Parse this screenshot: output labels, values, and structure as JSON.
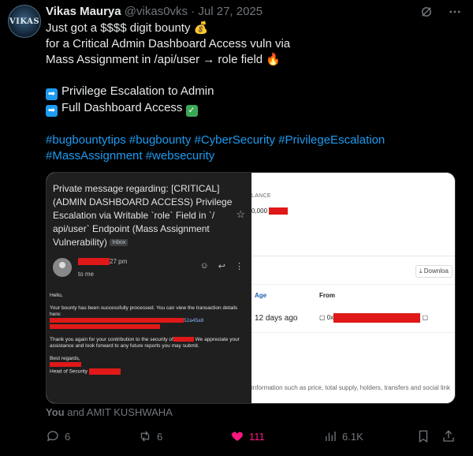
{
  "author": {
    "name": "Vikas Maurya",
    "handle": "@vikas0vks",
    "separator": "·",
    "date": "Jul 27, 2025",
    "avatar_text": "VIKAS"
  },
  "body": {
    "line1": "Just got a $$$$ digit bounty 💰",
    "line2": "for a Critical Admin Dashboard Access vuln via",
    "line3": "Mass Assignment in /api/user → role field 🔥",
    "bullet1": "Privilege Escalation to Admin",
    "bullet2": "Full Dashboard Access",
    "bullet_arrow": "➡",
    "check": "✓",
    "hashtags_line1": "#bugbountytips #bugbounty #CyberSecurity #PrivilegeEscalation",
    "hashtags_line2": "#MassAssignment #websecurity"
  },
  "email": {
    "subject": "Private message regarding: [CRITICAL] (ADMIN DASHBOARD ACCESS) Privilege Escalation via Writable `role` Field in `/ api/user` Endpoint (Mass Assignment Vulnerability)",
    "inbox_tag": "Inbox",
    "time_suffix": "27 pm",
    "to": "to me",
    "greeting": "Hello,",
    "para1": "Your bounty has been successfully processed. You can view the transaction details here:",
    "link_tail": "52a45a9",
    "para2_a": "Thank you again for your contribution to the security of",
    "para2_b": "We appreciate your assistance and look forward to any future reports you may submit.",
    "regards": "Best regards,",
    "signoff": "Head of Security"
  },
  "explorer": {
    "balance_label": "LANCE",
    "balance_value": "0,000",
    "download": "Downloa",
    "col_age": "Age",
    "col_from": "From",
    "age_value": "12 days ago",
    "from_prefix": "0x",
    "footer_note": "information such as price, total supply, holders, transfers and social link"
  },
  "liked_by": {
    "you": "You",
    "rest": "and AMIT KUSHWAHA"
  },
  "actions": {
    "replies": "6",
    "reposts": "6",
    "likes": "111",
    "views": "6.1K"
  },
  "colors": {
    "link": "#1d9bf0",
    "like": "#f91880",
    "muted": "#71767b",
    "redaction": "#e01818"
  }
}
